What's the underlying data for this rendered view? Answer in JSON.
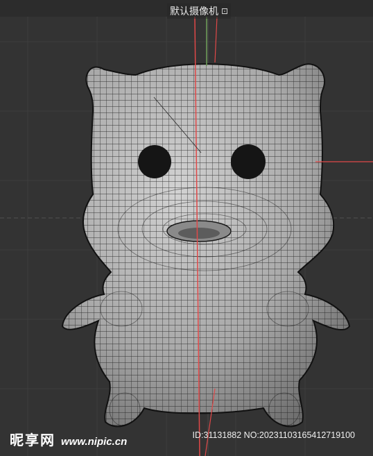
{
  "viewport": {
    "camera_label": "默认摄像机",
    "camera_icon": "camera-icon",
    "camera_icon_glyph": "⊡"
  },
  "watermark": {
    "logo_text": "昵享网",
    "url_text": "www.nipic.cn",
    "id_text": "ID:31131882 NO:20231103165412719100"
  },
  "colors": {
    "background": "#333333",
    "grid_line": "#3d3d3d",
    "axis_red": "#e04848",
    "axis_green": "#6fa35a",
    "mesh_fill": "#a9a9a9",
    "mesh_wire": "#1a1a1a",
    "eye": "#151515"
  }
}
